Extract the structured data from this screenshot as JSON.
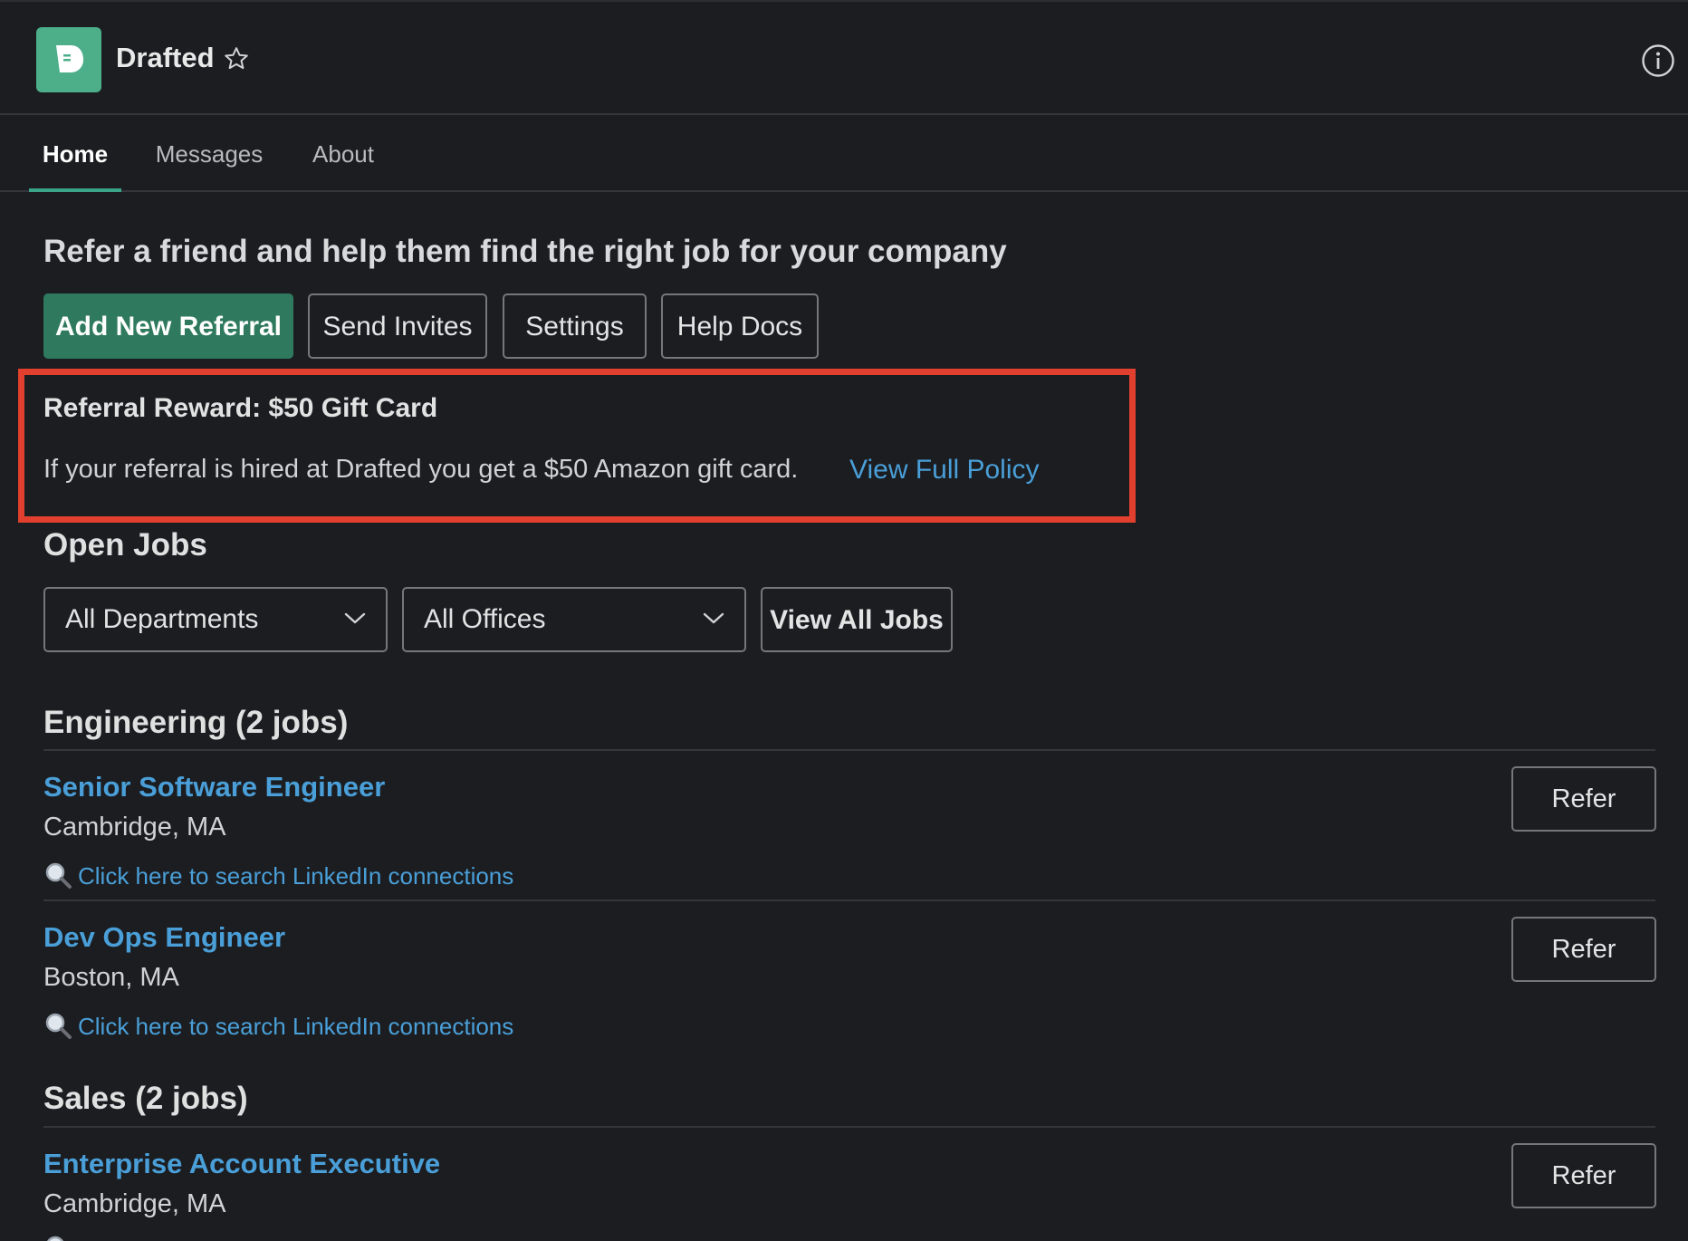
{
  "header": {
    "app_name": "Drafted",
    "logo_icon": "drafted-logo",
    "brand_color": "#4caf8a"
  },
  "tabs": [
    {
      "label": "Home",
      "active": true
    },
    {
      "label": "Messages",
      "active": false
    },
    {
      "label": "About",
      "active": false
    }
  ],
  "headline": "Refer a friend and help them find the right job for your company",
  "actions": {
    "add_referral": "Add New Referral",
    "send_invites": "Send Invites",
    "settings": "Settings",
    "help_docs": "Help Docs"
  },
  "reward": {
    "title": "Referral Reward: $50 Gift Card",
    "text": "If your referral is hired at Drafted you get a $50 Amazon gift card.",
    "policy_link": "View Full Policy"
  },
  "open_jobs": {
    "heading": "Open Jobs",
    "department_filter": "All Departments",
    "office_filter": "All Offices",
    "view_all": "View All Jobs"
  },
  "sections": [
    {
      "heading": "Engineering (2 jobs)",
      "jobs": [
        {
          "title": "Senior Software Engineer",
          "location": "Cambridge, MA",
          "linkedin": "Click here to search LinkedIn connections",
          "refer": "Refer"
        },
        {
          "title": "Dev Ops Engineer",
          "location": "Boston, MA",
          "linkedin": "Click here to search LinkedIn connections",
          "refer": "Refer"
        }
      ]
    },
    {
      "heading": "Sales (2 jobs)",
      "jobs": [
        {
          "title": "Enterprise Account Executive",
          "location": "Cambridge, MA",
          "refer": "Refer"
        }
      ]
    }
  ],
  "colors": {
    "accent": "#3aa58a",
    "primary_button": "#2f7a5f",
    "link": "#4a9fd8",
    "highlight": "#e2402e"
  }
}
